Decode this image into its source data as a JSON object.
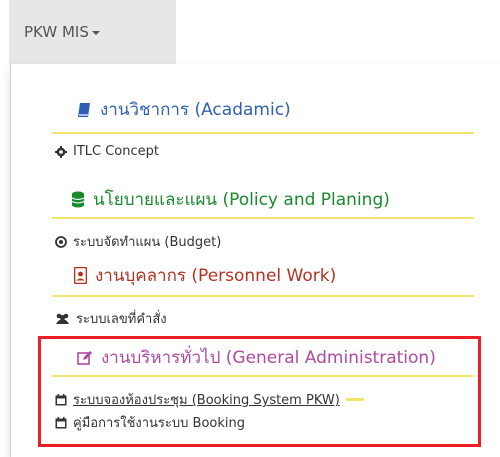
{
  "menu": {
    "title": "PKW MIS"
  },
  "sections": {
    "academic": {
      "label": "งานวิชาการ (Acadamic)",
      "color": "#2f5fb3",
      "icon": "book-icon"
    },
    "itlc": {
      "label": "ITLC Concept",
      "icon": "gear-icon"
    },
    "policy": {
      "label": "นโยบายและแผน (Policy and Planing)",
      "color": "#1a8a2e",
      "icon": "database-icon"
    },
    "budget": {
      "label": "ระบบจัดทำแผน (Budget)",
      "icon": "circle-arrow-icon"
    },
    "personnel": {
      "label": "งานบุคลากร (Personnel Work)",
      "color": "#b3321f",
      "icon": "id-badge-icon"
    },
    "command": {
      "label": "ระบบเลขที่คำสั่ง",
      "icon": "users-icon"
    },
    "general": {
      "label": "งานบริหารทั่วไป (General Administration)",
      "color": "#b04aa5",
      "icon": "edit-icon"
    },
    "booking": {
      "label": "ระบบจองห้องประชุม (Booking System PKW)",
      "icon": "calendar-icon"
    },
    "manual": {
      "label": "คู่มือการใช้งานระบบ Booking",
      "icon": "calendar-icon"
    }
  },
  "colors": {
    "accent_rule": "#f2e66a",
    "highlight_box": "#ee1c24"
  }
}
